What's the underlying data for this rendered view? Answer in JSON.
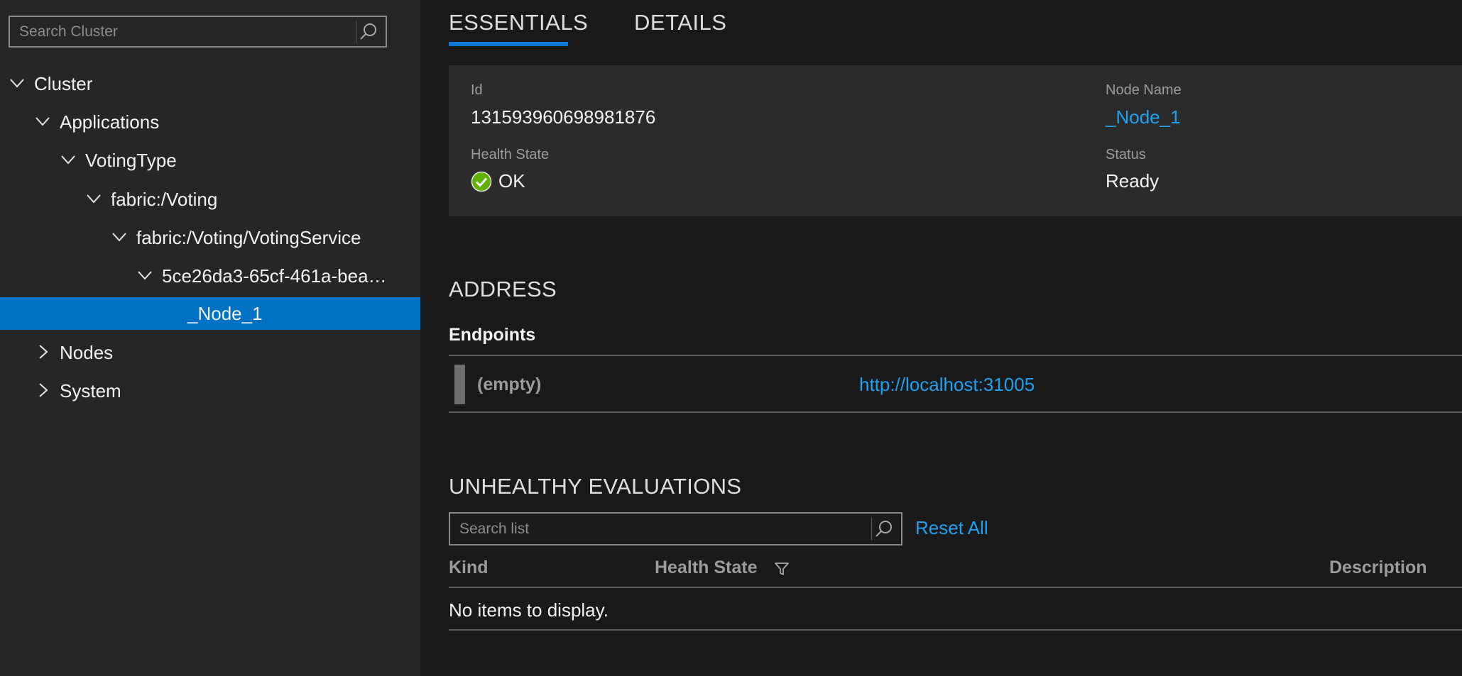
{
  "sidebar": {
    "search_placeholder": "Search Cluster",
    "tree": [
      {
        "label": "Cluster",
        "expanded": true
      },
      {
        "label": "Applications",
        "expanded": true
      },
      {
        "label": "VotingType",
        "expanded": true
      },
      {
        "label": "fabric:/Voting",
        "expanded": true
      },
      {
        "label": "fabric:/Voting/VotingService",
        "expanded": true
      },
      {
        "label": "5ce26da3-65cf-461a-bea…",
        "expanded": true
      },
      {
        "label": "_Node_1",
        "selected": true
      },
      {
        "label": "Nodes",
        "expanded": false
      },
      {
        "label": "System",
        "expanded": false
      }
    ]
  },
  "tabs": [
    {
      "label": "ESSENTIALS",
      "active": true
    },
    {
      "label": "DETAILS",
      "active": false
    }
  ],
  "essentials": {
    "id_label": "Id",
    "id_value": "131593960698981876",
    "node_name_label": "Node Name",
    "node_name_value": "_Node_1",
    "health_state_label": "Health State",
    "health_state_value": "OK",
    "status_label": "Status",
    "status_value": "Ready"
  },
  "address": {
    "heading": "ADDRESS",
    "endpoints_label": "Endpoints",
    "endpoints": [
      {
        "name": "(empty)",
        "url": "http://localhost:31005"
      }
    ]
  },
  "unhealthy_evaluations": {
    "heading": "UNHEALTHY EVALUATIONS",
    "search_placeholder": "Search list",
    "reset_label": "Reset All",
    "columns": [
      "Kind",
      "Health State",
      "Description"
    ],
    "empty_message": "No items to display."
  },
  "colors": {
    "accent": "#0072c6",
    "link": "#1ea1f2",
    "ok_green": "#5db300",
    "sidebar_bg": "#262626",
    "main_bg": "#191919"
  },
  "icons": {
    "search": "search-icon",
    "expand": "chevron-down-icon",
    "collapse": "chevron-right-icon",
    "ok": "ok-check-icon",
    "filter": "filter-icon"
  }
}
